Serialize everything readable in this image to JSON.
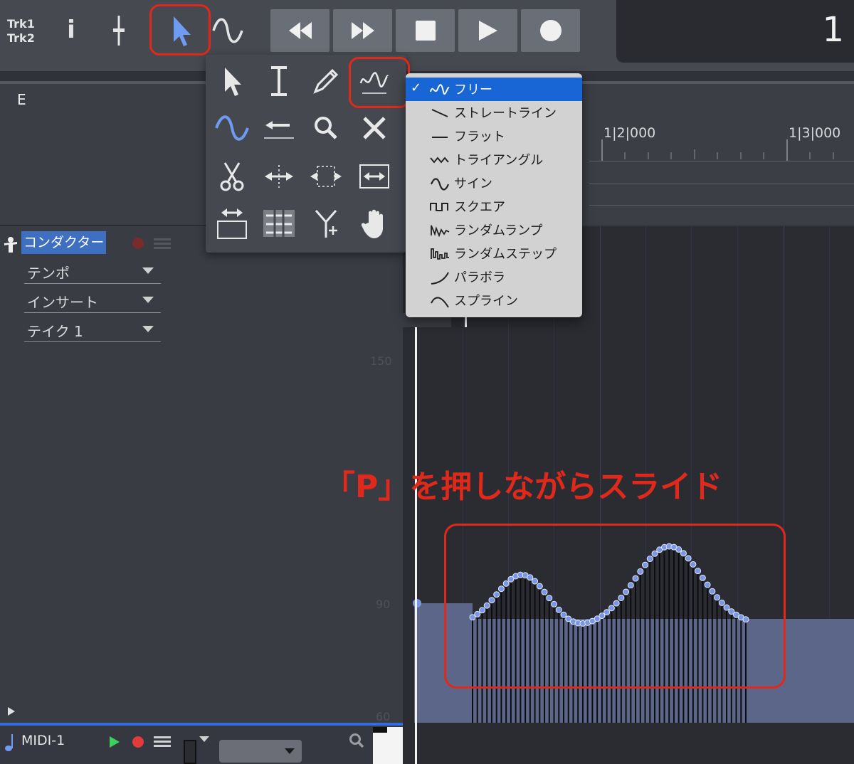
{
  "toolbar": {
    "track_label_1": "Trk1",
    "track_label_2": "Trk2",
    "info_icon": "i",
    "counter_value": "1"
  },
  "left_panel": {
    "header_label": "E",
    "conductor_label": "コンダクター",
    "params": [
      {
        "label": "テンポ"
      },
      {
        "label": "インサート"
      },
      {
        "label": "テイク 1"
      }
    ],
    "midi_track_label": "MIDI-1"
  },
  "ruler": {
    "labels": [
      "1|2|000",
      "1|3|000"
    ]
  },
  "graph": {
    "axis_labels": [
      "150",
      "90",
      "60"
    ]
  },
  "curve_menu": {
    "items": [
      {
        "label": "フリー",
        "icon": "free-curve-icon",
        "selected": true
      },
      {
        "label": "ストレートライン",
        "icon": "straight-line-icon",
        "selected": false
      },
      {
        "label": "フラット",
        "icon": "flat-line-icon",
        "selected": false
      },
      {
        "label": "トライアングル",
        "icon": "triangle-wave-icon",
        "selected": false
      },
      {
        "label": "サイン",
        "icon": "sine-wave-icon",
        "selected": false
      },
      {
        "label": "スクエア",
        "icon": "square-wave-icon",
        "selected": false
      },
      {
        "label": "ランダムランプ",
        "icon": "random-ramp-icon",
        "selected": false
      },
      {
        "label": "ランダムステップ",
        "icon": "random-step-icon",
        "selected": false
      },
      {
        "label": "パラボラ",
        "icon": "parabola-icon",
        "selected": false
      },
      {
        "label": "スプライン",
        "icon": "spline-icon",
        "selected": false
      }
    ],
    "check_mark": "✓"
  },
  "annotation": {
    "text": "「P」を押しながらスライド",
    "color": "#e0291a"
  },
  "colors": {
    "highlight": "#e0291a",
    "selection": "#1865d6",
    "curve_points": "#7a97e6"
  }
}
